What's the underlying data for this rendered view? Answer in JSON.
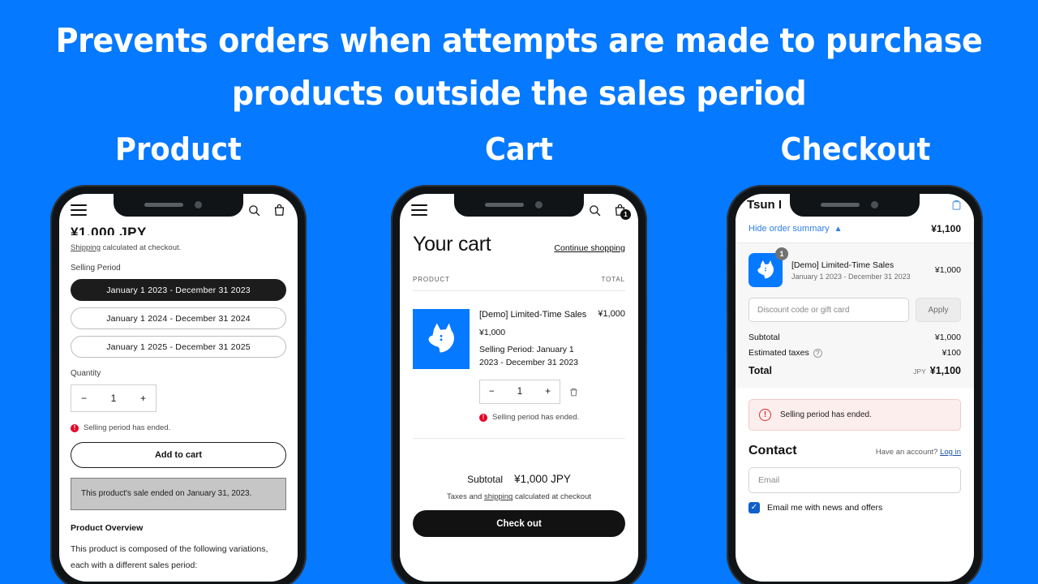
{
  "headline": {
    "line1": "Prevents orders when attempts are made to purchase",
    "line2": "products outside the sales period"
  },
  "captions": {
    "product": "Product",
    "cart": "Cart",
    "checkout": "Checkout"
  },
  "colors": {
    "background_blue": "#0579ff",
    "brand_blue": "#0579ff",
    "error_red": "#e60023",
    "dark": "#121212",
    "link_blue": "#2f7ee6"
  },
  "product_screen": {
    "store_bar": {
      "menu_icon": "hamburger-icon",
      "search_icon": "search-icon",
      "cart_icon": "cart-icon"
    },
    "price_cut_off": "¥1,000 JPY",
    "shipping_link": "Shipping",
    "shipping_rest": " calculated at checkout.",
    "selling_period_label": "Selling Period",
    "variants": [
      {
        "label": "January 1 2023 - December 31 2023",
        "selected": true
      },
      {
        "label": "January 1 2024 - December 31 2024",
        "selected": false
      },
      {
        "label": "January 1 2025 - December 31 2025",
        "selected": false
      }
    ],
    "quantity_label": "Quantity",
    "quantity": {
      "minus": "−",
      "value": "1",
      "plus": "+"
    },
    "error_text": "Selling period has ended.",
    "error_badge": "!",
    "add_to_cart": "Add to cart",
    "notice": "This product's sale ended on January 31, 2023.",
    "overview_title": "Product Overview",
    "overview_text": "This product is composed of the following variations, each with a different sales period:"
  },
  "cart_screen": {
    "store_bar": {
      "menu_icon": "hamburger-icon",
      "search_icon": "search-icon",
      "cart_icon": "cart-icon",
      "cart_badge": "1"
    },
    "title": "Your cart",
    "continue_shopping": "Continue shopping",
    "columns": {
      "product": "PRODUCT",
      "total": "TOTAL"
    },
    "item": {
      "thumb_icon": "dog-logo-icon",
      "name": "[Demo] Limited-Time Sales",
      "price": "¥1,000",
      "period": "Selling Period: January 1 2023 - December 31 2023",
      "line_total": "¥1,000",
      "quantity": {
        "minus": "−",
        "value": "1",
        "plus": "+"
      },
      "remove_icon": "trash-icon",
      "error_text": "Selling period has ended.",
      "error_badge": "!"
    },
    "subtotal_label": "Subtotal",
    "subtotal_value": "¥1,000 JPY",
    "tax_note_pre": "Taxes and ",
    "tax_note_link": "shipping",
    "tax_note_post": " calculated at checkout",
    "checkout_button": "Check out"
  },
  "checkout_screen": {
    "store_name": "Tsun I",
    "bag_icon": "bag-icon",
    "hide_summary": "Hide order summary",
    "chevron_icon": "chevron-up-icon",
    "summary_amount": "¥1,100",
    "item": {
      "thumb_icon": "dog-logo-icon",
      "qty_badge": "1",
      "name": "[Demo] Limited-Time Sales",
      "variant": "January 1 2023 - December 31 2023",
      "price": "¥1,000"
    },
    "discount_placeholder": "Discount code or gift card",
    "apply_button": "Apply",
    "rows": [
      {
        "label": "Subtotal",
        "value": "¥1,000",
        "info": false
      },
      {
        "label": "Estimated taxes",
        "value": "¥100",
        "info": true
      }
    ],
    "total_label": "Total",
    "total_currency": "JPY",
    "total_value": "¥1,100",
    "alert_text": "Selling period has ended.",
    "alert_icon": "alert-circle-icon",
    "contact_heading": "Contact",
    "account_prompt": "Have an account?",
    "login_link": "Log in",
    "email_placeholder": "Email",
    "newsletter_label": "Email me with news and offers",
    "newsletter_checked": true,
    "check_icon": "check-icon"
  }
}
